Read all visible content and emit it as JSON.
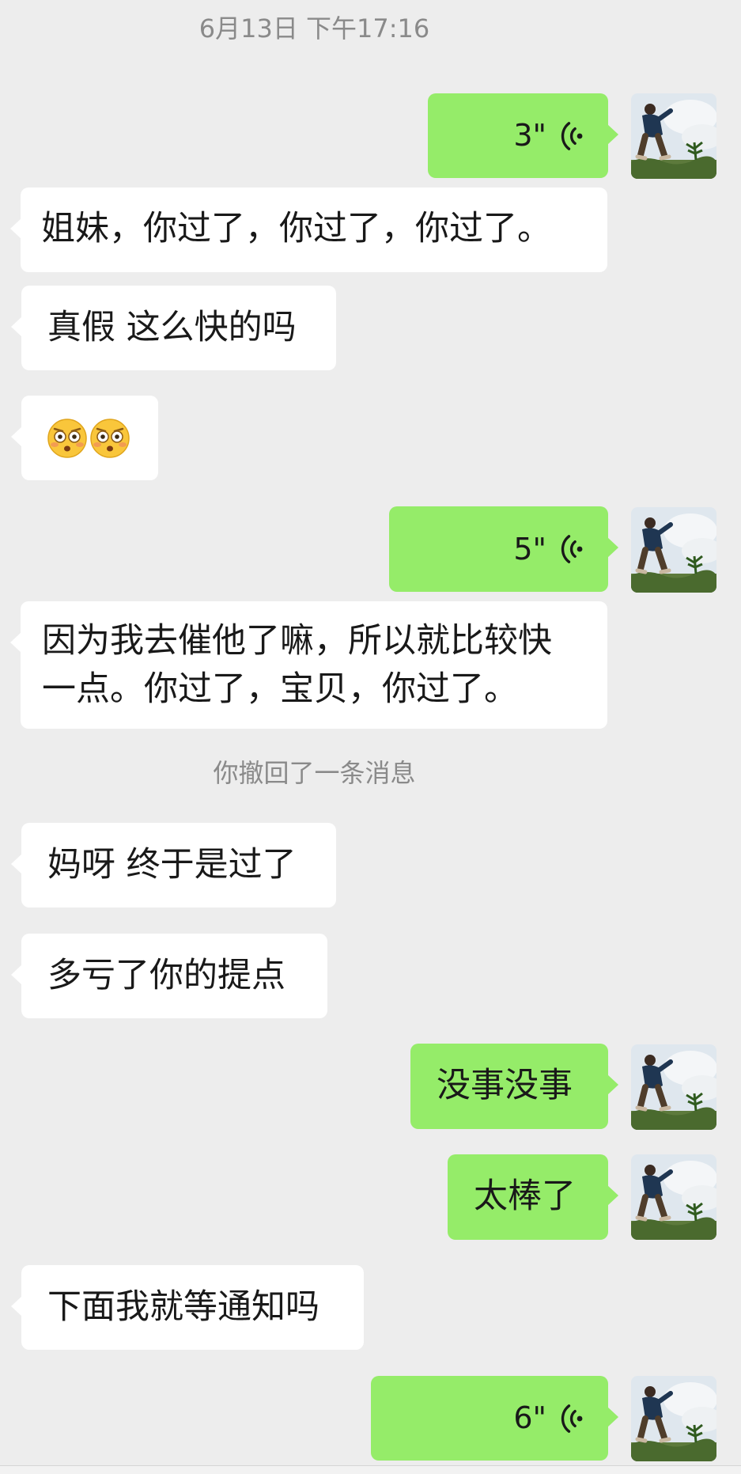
{
  "timestamp": "6月13日 下午17:16",
  "recall_notice": "你撤回了一条消息",
  "messages": {
    "m1": {
      "duration": "3\""
    },
    "m2": {
      "text": "姐妹，你过了，你过了，你过了。"
    },
    "m3": {
      "text": "真假 这么快的吗"
    },
    "m4": {
      "emoji": "flushed-face-icon x2"
    },
    "m5": {
      "duration": "5\""
    },
    "m6": {
      "line1": "因为我去催他了嘛，所以就比较快",
      "line2": "一点。你过了，宝贝，你过了。"
    },
    "m8": {
      "text": "妈呀 终于是过了"
    },
    "m9": {
      "text": "多亏了你的提点"
    },
    "m10": {
      "text": "没事没事"
    },
    "m11": {
      "text": "太棒了"
    },
    "m12": {
      "text": "下面我就等通知吗"
    },
    "m13": {
      "duration": "6\""
    }
  },
  "colors": {
    "background": "#ededed",
    "incoming": "#ffffff",
    "outgoing": "#95ec69",
    "meta": "#8a8a8a"
  }
}
